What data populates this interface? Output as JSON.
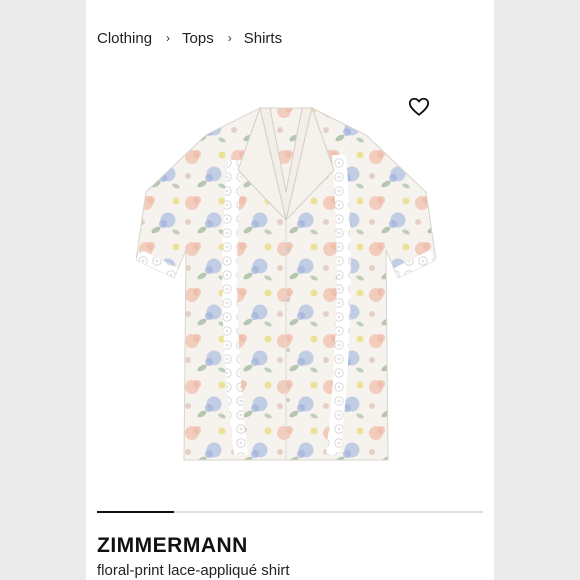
{
  "breadcrumb": {
    "items": [
      "Clothing",
      "Tops",
      "Shirts"
    ],
    "separator": "›"
  },
  "wishlist": {
    "icon": "heart-outline-icon"
  },
  "product_image": {
    "subject": "white short-sleeve shirt with floral print and lace appliqué"
  },
  "gallery": {
    "progress_fraction": 0.2
  },
  "product": {
    "brand": "ZIMMERMANN",
    "description": "floral-print lace-appliqué shirt"
  },
  "colors": {
    "background": "#ebebeb",
    "card": "#ffffff",
    "text": "#222222",
    "progress_fill": "#111111",
    "progress_track": "#dedede"
  }
}
